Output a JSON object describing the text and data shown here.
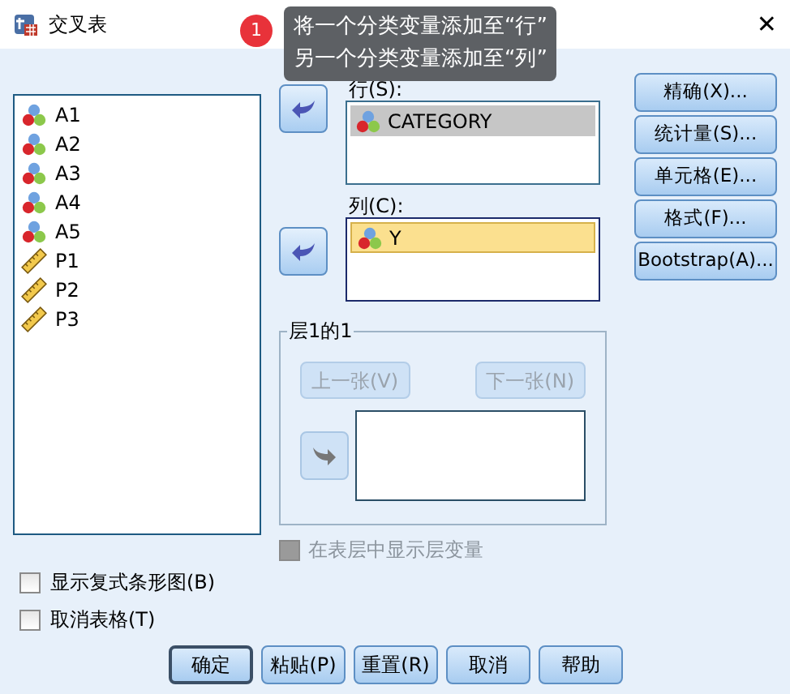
{
  "window": {
    "title": "交叉表",
    "close": "✕"
  },
  "tooltip": {
    "badge": "1",
    "lines": [
      "将一个分类变量添加至“行”",
      "另一个分类变量添加至“列”"
    ]
  },
  "variables": [
    {
      "name": "A1",
      "kind": "nominal"
    },
    {
      "name": "A2",
      "kind": "nominal"
    },
    {
      "name": "A3",
      "kind": "nominal"
    },
    {
      "name": "A4",
      "kind": "nominal"
    },
    {
      "name": "A5",
      "kind": "nominal"
    },
    {
      "name": "P1",
      "kind": "scale"
    },
    {
      "name": "P2",
      "kind": "scale"
    },
    {
      "name": "P3",
      "kind": "scale"
    }
  ],
  "rows": {
    "label": "行(S):",
    "focused": false,
    "items": [
      {
        "name": "CATEGORY",
        "kind": "nominal",
        "selected": true
      }
    ]
  },
  "columns": {
    "label": "列(C):",
    "focused": true,
    "items": [
      {
        "name": "Y",
        "kind": "nominal",
        "selected": true
      }
    ]
  },
  "layer": {
    "title": "层1的1",
    "previous": {
      "label": "上一张(V)",
      "disabled": true
    },
    "next": {
      "label": "下一张(N)",
      "disabled": true
    },
    "arrow_disabled": true
  },
  "show_layer": {
    "label": "在表层中显示层变量",
    "checked": false,
    "disabled": true
  },
  "options": [
    {
      "label": "显示复式条形图(B)",
      "checked": false
    },
    {
      "label": "取消表格(T)",
      "checked": false
    }
  ],
  "side_buttons": [
    "精确(X)...",
    "统计量(S)...",
    "单元格(E)...",
    "格式(F)...",
    "Bootstrap(A)..."
  ],
  "buttons": [
    {
      "label": "确定",
      "default": true
    },
    {
      "label": "粘贴(P)",
      "default": false
    },
    {
      "label": "重置(R)",
      "default": false
    },
    {
      "label": "取消",
      "default": false
    },
    {
      "label": "帮助",
      "default": false
    }
  ]
}
